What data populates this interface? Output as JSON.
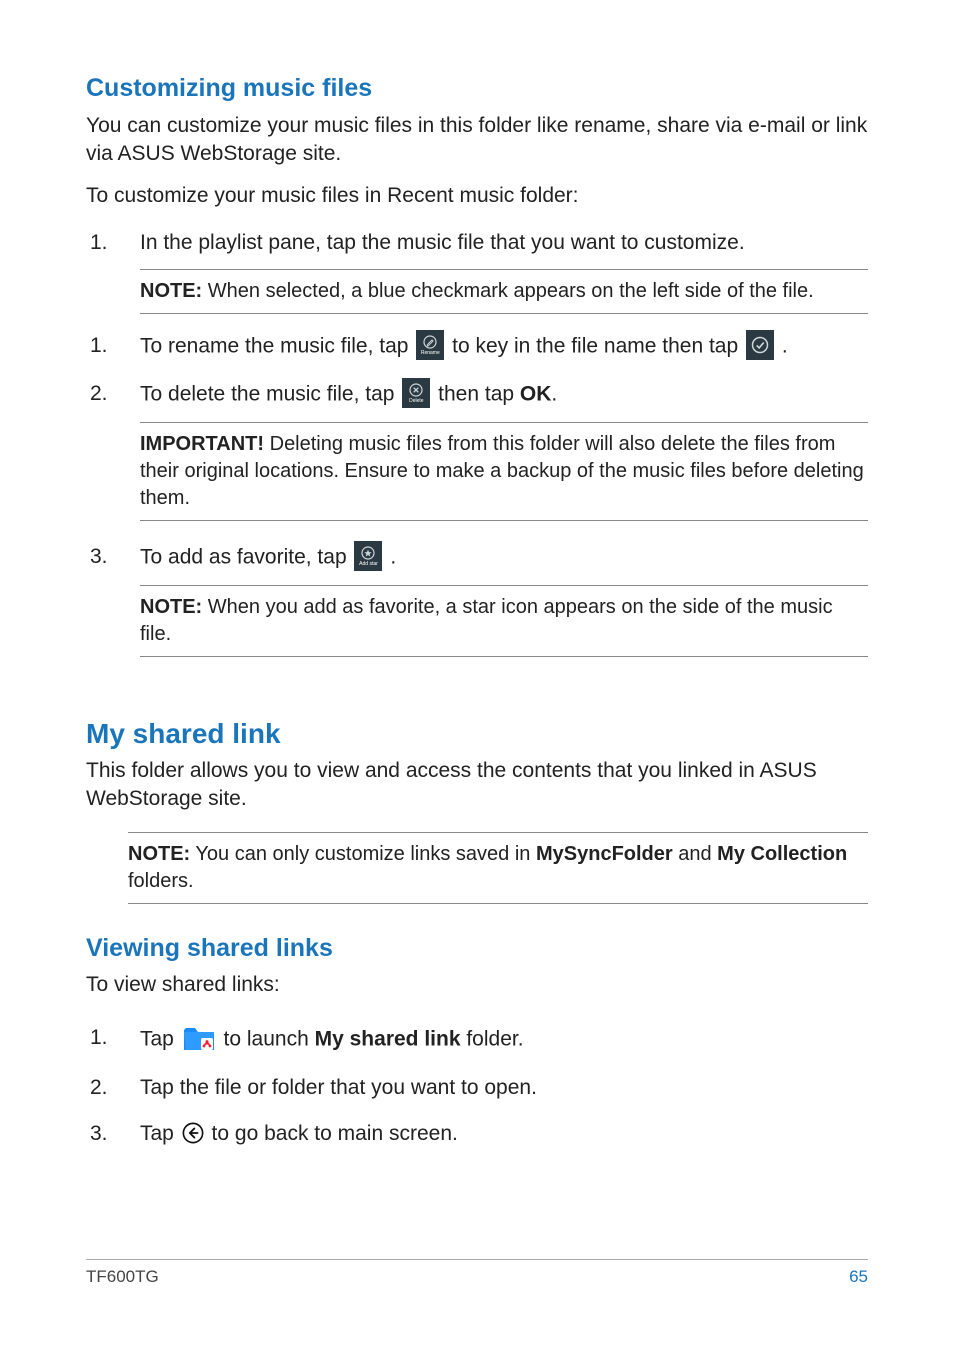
{
  "sec1": {
    "heading": "Customizing music files",
    "intro": "You can customize your music files in this folder like rename, share via e-mail or link via ASUS WebStorage site.",
    "lead": "To customize your music files in Recent music folder:",
    "steps": {
      "s1_num": "1.",
      "s1_text": "In the playlist pane, tap the music file that you want to customize.",
      "note1_label": "NOTE:",
      "note1_body": "  When selected, a blue checkmark appears on the left side of the file.",
      "s2_num": "1.",
      "s2_a": "To rename the music file, tap ",
      "s2_b": " to key in the file name then tap ",
      "s2_c": ".",
      "s3_num": "2.",
      "s3_a": "To delete the music file, tap ",
      "s3_b": " then tap ",
      "s3_ok": "OK",
      "s3_c": ".",
      "imp_label": "IMPORTANT!",
      "imp_body": "  Deleting music files from this folder will also delete the files from their original locations. Ensure to make a backup of the music files before deleting them.",
      "s4_num": "3.",
      "s4_a": "To add as favorite, tap ",
      "s4_b": ".",
      "note2_label": "NOTE:",
      "note2_body": "  When you add as favorite, a star icon appears on the side of the music file."
    },
    "icon_labels": {
      "rename": "Rename",
      "delete": "Delete",
      "addstar": "Add star"
    }
  },
  "sec2": {
    "heading": "My shared link",
    "intro": "This folder allows you to view and access the contents that you linked in ASUS WebStorage site.",
    "note_label": "NOTE:",
    "note_a": "  You can only customize links saved in ",
    "note_b1": "MySyncFolder",
    "note_mid": " and ",
    "note_b2": "My Collection",
    "note_c": " folders."
  },
  "sec3": {
    "heading": "Viewing shared links",
    "lead": "To view shared links:",
    "s1_num": "1.",
    "s1_a": "Tap ",
    "s1_b": " to launch ",
    "s1_bold": "My shared link",
    "s1_c": " folder.",
    "s2_num": "2.",
    "s2_text": "Tap the file or folder that you want to open.",
    "s3_num": "3.",
    "s3_a": "Tap ",
    "s3_b": " to go back to main screen."
  },
  "footer": {
    "model": "TF600TG",
    "page": "65"
  }
}
